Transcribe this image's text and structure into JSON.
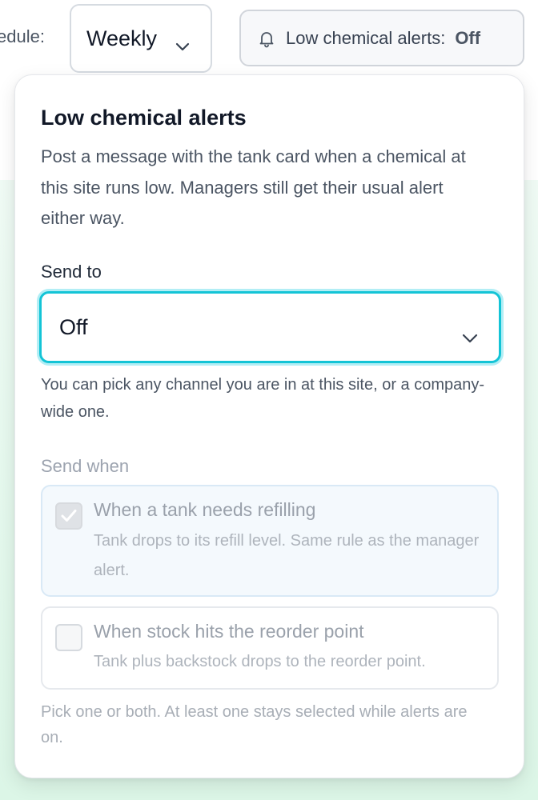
{
  "topbar": {
    "schedule_label": "edule:",
    "schedule_value": "Weekly",
    "alerts_button_label": "Low chemical alerts:",
    "alerts_button_state": "Off"
  },
  "popover": {
    "title": "Low chemical alerts",
    "description": "Post a message with the tank card when a chemical at this site runs low. Managers still get their usual alert either way.",
    "send_to": {
      "label": "Send to",
      "value": "Off",
      "hint": "You can pick any channel you are in at this site, or a company-wide one."
    },
    "send_when": {
      "label": "Send when",
      "options": [
        {
          "title": "When a tank needs refilling",
          "description": "Tank drops to its refill level. Same rule as the manager alert.",
          "checked": true,
          "disabled": true
        },
        {
          "title": "When stock hits the reorder point",
          "description": "Tank plus backstock drops to the reorder point.",
          "checked": false,
          "disabled": true
        }
      ]
    },
    "footer_note": "Pick one or both. At least one stays selected while alerts are on."
  },
  "icons": {
    "chevron": "chevron-down-icon",
    "bell": "bell-icon",
    "check": "check-icon"
  },
  "colors": {
    "focus_ring": "#13c4d6",
    "background_tint": "#e3f8ec"
  }
}
